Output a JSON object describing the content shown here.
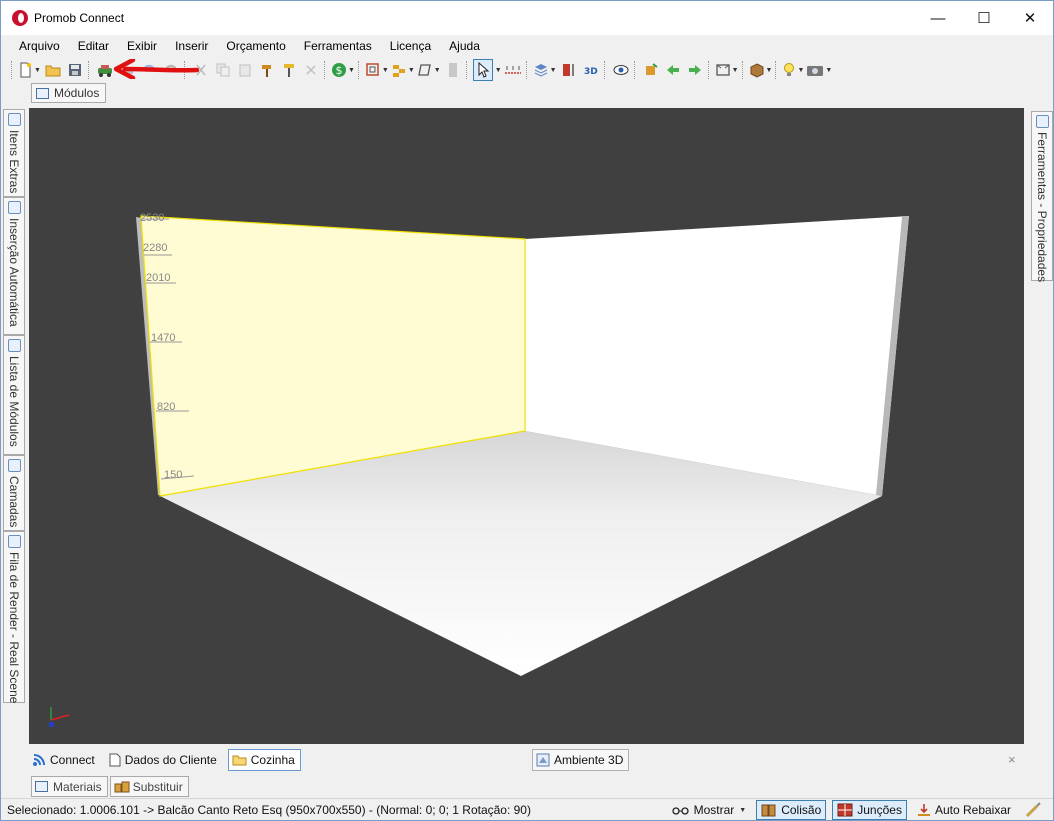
{
  "window": {
    "title": "Promob Connect",
    "minimize": "—",
    "maximize": "☐",
    "close": "✕"
  },
  "menu": [
    "Arquivo",
    "Editar",
    "Exibir",
    "Inserir",
    "Orçamento",
    "Ferramentas",
    "Licença",
    "Ajuda"
  ],
  "panels": {
    "modulos": "Módulos",
    "left_tabs": [
      "Itens Extras",
      "Inserção Automática",
      "Lista de Módulos",
      "Camadas",
      "Fila de Render - Real Scene"
    ],
    "right_tab": "Ferramentas - Propriedades"
  },
  "viewport": {
    "wall_labels": [
      "2530",
      "2280",
      "2010",
      "1470",
      "820",
      "150"
    ]
  },
  "doc_tabs": {
    "connect": "Connect",
    "dados_cliente": "Dados do Cliente",
    "cozinha": "Cozinha",
    "ambiente": "Ambiente 3D",
    "close": "×"
  },
  "lower_tabs": {
    "materiais": "Materiais",
    "substituir": "Substituir"
  },
  "status": {
    "text": "Selecionado: 1.0006.101 -> Balcão Canto Reto Esq (950x700x550) - (Normal: 0; 0; 1 Rotação: 90)",
    "mostrar": "Mostrar",
    "colisao": "Colisão",
    "juncoes": "Junções",
    "auto_rebaixar": "Auto Rebaixar"
  },
  "colors": {
    "accent": "#3c7fb1",
    "annotation": "#e01010",
    "viewport_bg": "#404040",
    "highlight_wall": "#fffbd2"
  }
}
